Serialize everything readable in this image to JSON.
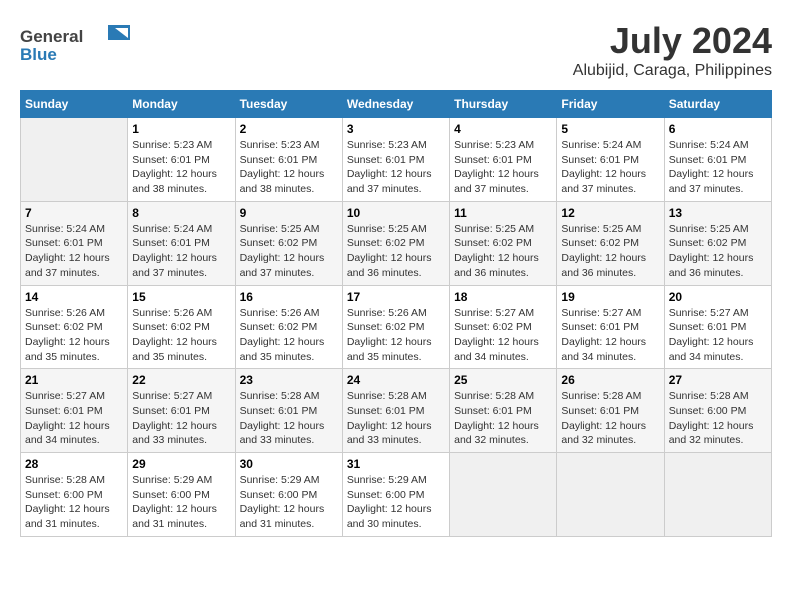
{
  "header": {
    "logo_general": "General",
    "logo_blue": "Blue",
    "title": "July 2024",
    "subtitle": "Alubijid, Caraga, Philippines"
  },
  "calendar": {
    "days_of_week": [
      "Sunday",
      "Monday",
      "Tuesday",
      "Wednesday",
      "Thursday",
      "Friday",
      "Saturday"
    ],
    "weeks": [
      [
        {
          "day": "",
          "content": ""
        },
        {
          "day": "1",
          "content": "Sunrise: 5:23 AM\nSunset: 6:01 PM\nDaylight: 12 hours\nand 38 minutes."
        },
        {
          "day": "2",
          "content": "Sunrise: 5:23 AM\nSunset: 6:01 PM\nDaylight: 12 hours\nand 38 minutes."
        },
        {
          "day": "3",
          "content": "Sunrise: 5:23 AM\nSunset: 6:01 PM\nDaylight: 12 hours\nand 37 minutes."
        },
        {
          "day": "4",
          "content": "Sunrise: 5:23 AM\nSunset: 6:01 PM\nDaylight: 12 hours\nand 37 minutes."
        },
        {
          "day": "5",
          "content": "Sunrise: 5:24 AM\nSunset: 6:01 PM\nDaylight: 12 hours\nand 37 minutes."
        },
        {
          "day": "6",
          "content": "Sunrise: 5:24 AM\nSunset: 6:01 PM\nDaylight: 12 hours\nand 37 minutes."
        }
      ],
      [
        {
          "day": "7",
          "content": "Sunrise: 5:24 AM\nSunset: 6:01 PM\nDaylight: 12 hours\nand 37 minutes."
        },
        {
          "day": "8",
          "content": "Sunrise: 5:24 AM\nSunset: 6:01 PM\nDaylight: 12 hours\nand 37 minutes."
        },
        {
          "day": "9",
          "content": "Sunrise: 5:25 AM\nSunset: 6:02 PM\nDaylight: 12 hours\nand 37 minutes."
        },
        {
          "day": "10",
          "content": "Sunrise: 5:25 AM\nSunset: 6:02 PM\nDaylight: 12 hours\nand 36 minutes."
        },
        {
          "day": "11",
          "content": "Sunrise: 5:25 AM\nSunset: 6:02 PM\nDaylight: 12 hours\nand 36 minutes."
        },
        {
          "day": "12",
          "content": "Sunrise: 5:25 AM\nSunset: 6:02 PM\nDaylight: 12 hours\nand 36 minutes."
        },
        {
          "day": "13",
          "content": "Sunrise: 5:25 AM\nSunset: 6:02 PM\nDaylight: 12 hours\nand 36 minutes."
        }
      ],
      [
        {
          "day": "14",
          "content": "Sunrise: 5:26 AM\nSunset: 6:02 PM\nDaylight: 12 hours\nand 35 minutes."
        },
        {
          "day": "15",
          "content": "Sunrise: 5:26 AM\nSunset: 6:02 PM\nDaylight: 12 hours\nand 35 minutes."
        },
        {
          "day": "16",
          "content": "Sunrise: 5:26 AM\nSunset: 6:02 PM\nDaylight: 12 hours\nand 35 minutes."
        },
        {
          "day": "17",
          "content": "Sunrise: 5:26 AM\nSunset: 6:02 PM\nDaylight: 12 hours\nand 35 minutes."
        },
        {
          "day": "18",
          "content": "Sunrise: 5:27 AM\nSunset: 6:02 PM\nDaylight: 12 hours\nand 34 minutes."
        },
        {
          "day": "19",
          "content": "Sunrise: 5:27 AM\nSunset: 6:01 PM\nDaylight: 12 hours\nand 34 minutes."
        },
        {
          "day": "20",
          "content": "Sunrise: 5:27 AM\nSunset: 6:01 PM\nDaylight: 12 hours\nand 34 minutes."
        }
      ],
      [
        {
          "day": "21",
          "content": "Sunrise: 5:27 AM\nSunset: 6:01 PM\nDaylight: 12 hours\nand 34 minutes."
        },
        {
          "day": "22",
          "content": "Sunrise: 5:27 AM\nSunset: 6:01 PM\nDaylight: 12 hours\nand 33 minutes."
        },
        {
          "day": "23",
          "content": "Sunrise: 5:28 AM\nSunset: 6:01 PM\nDaylight: 12 hours\nand 33 minutes."
        },
        {
          "day": "24",
          "content": "Sunrise: 5:28 AM\nSunset: 6:01 PM\nDaylight: 12 hours\nand 33 minutes."
        },
        {
          "day": "25",
          "content": "Sunrise: 5:28 AM\nSunset: 6:01 PM\nDaylight: 12 hours\nand 32 minutes."
        },
        {
          "day": "26",
          "content": "Sunrise: 5:28 AM\nSunset: 6:01 PM\nDaylight: 12 hours\nand 32 minutes."
        },
        {
          "day": "27",
          "content": "Sunrise: 5:28 AM\nSunset: 6:00 PM\nDaylight: 12 hours\nand 32 minutes."
        }
      ],
      [
        {
          "day": "28",
          "content": "Sunrise: 5:28 AM\nSunset: 6:00 PM\nDaylight: 12 hours\nand 31 minutes."
        },
        {
          "day": "29",
          "content": "Sunrise: 5:29 AM\nSunset: 6:00 PM\nDaylight: 12 hours\nand 31 minutes."
        },
        {
          "day": "30",
          "content": "Sunrise: 5:29 AM\nSunset: 6:00 PM\nDaylight: 12 hours\nand 31 minutes."
        },
        {
          "day": "31",
          "content": "Sunrise: 5:29 AM\nSunset: 6:00 PM\nDaylight: 12 hours\nand 30 minutes."
        },
        {
          "day": "",
          "content": ""
        },
        {
          "day": "",
          "content": ""
        },
        {
          "day": "",
          "content": ""
        }
      ]
    ]
  }
}
